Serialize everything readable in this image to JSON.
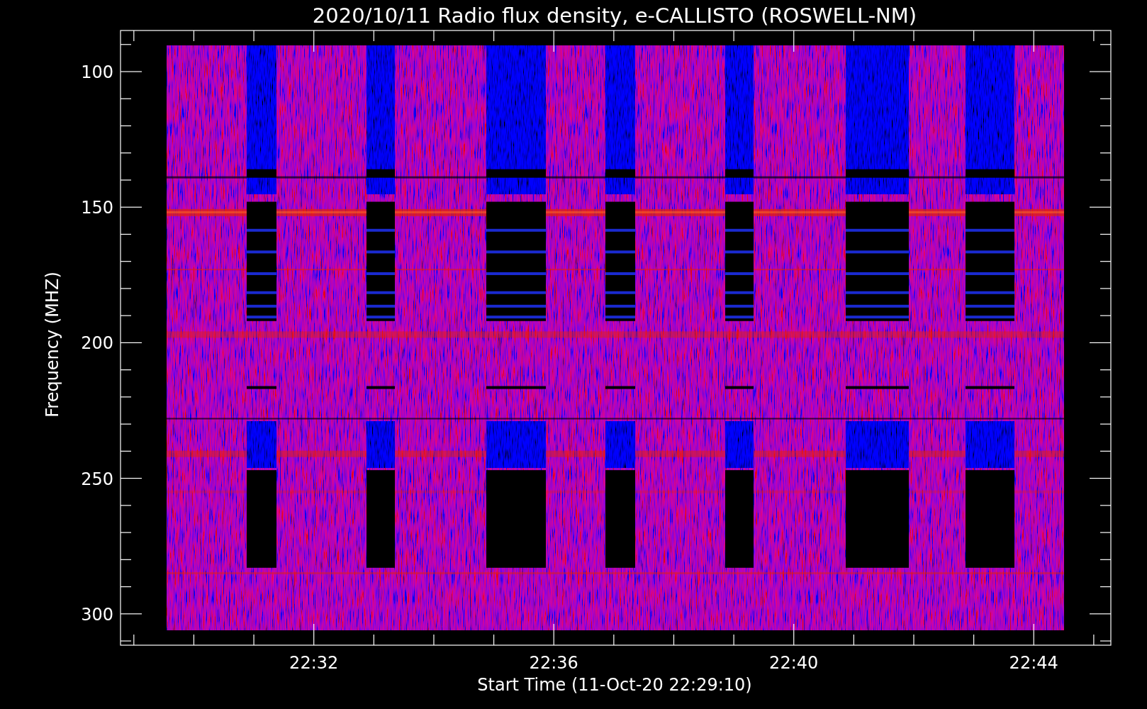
{
  "title": "2020/10/11  Radio flux density, e-CALLISTO (ROSWELL-NM)",
  "y_axis": {
    "label": "Frequency (MHZ)",
    "ticks": [
      "100",
      "150",
      "200",
      "250",
      "300"
    ]
  },
  "x_axis": {
    "label": "Start Time (11-Oct-20 22:29:10)",
    "ticks": [
      "22:32",
      "22:36",
      "22:40",
      "22:44"
    ]
  }
}
